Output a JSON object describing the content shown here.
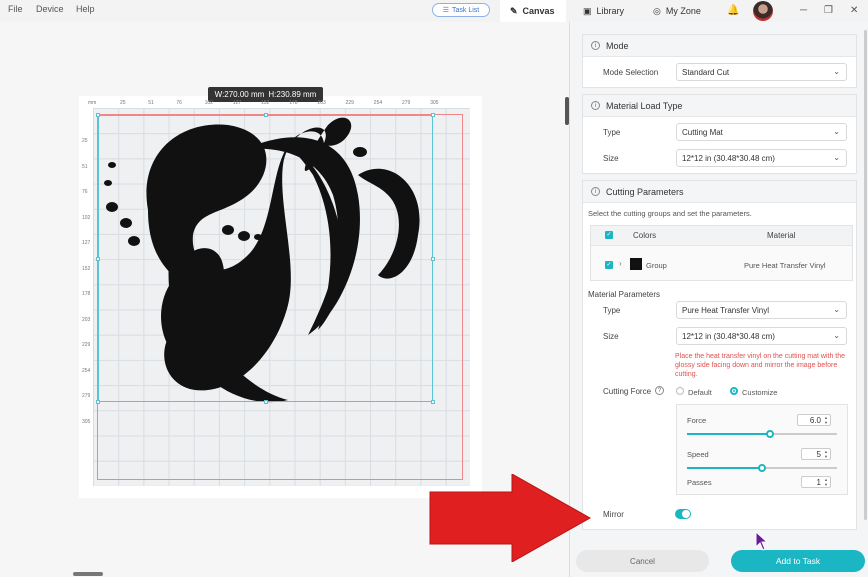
{
  "menu": {
    "file": "File",
    "device": "Device",
    "help": "Help"
  },
  "task_list": "Task List",
  "tabs": {
    "canvas": "Canvas",
    "library": "Library",
    "myzone": "My Zone"
  },
  "icons": {
    "task_list": "list-icon",
    "canvas": "canvas-icon",
    "library": "library-icon",
    "myzone": "myzone-icon",
    "bell": "bell-icon",
    "minimize": "minimize-icon",
    "restore": "restore-icon",
    "close": "close-icon"
  },
  "canvas": {
    "dimension_w": "W:270.00 mm",
    "dimension_h": "H:230.89 mm",
    "ruler_unit": "mm",
    "ruler_top": [
      "25",
      "51",
      "76",
      "102",
      "127",
      "152",
      "178",
      "203",
      "229",
      "254",
      "279",
      "305"
    ],
    "ruler_left": [
      "25",
      "51",
      "76",
      "102",
      "127",
      "152",
      "178",
      "203",
      "229",
      "254",
      "279",
      "305"
    ]
  },
  "panel": {
    "mode": {
      "title": "Mode",
      "selection_label": "Mode Selection",
      "selection_value": "Standard Cut"
    },
    "material_load": {
      "title": "Material Load Type",
      "type_label": "Type",
      "type_value": "Cutting Mat",
      "size_label": "Size",
      "size_value": "12*12 in (30.48*30.48 cm)"
    },
    "cutting": {
      "title": "Cutting Parameters",
      "instruction": "Select the cutting groups and set the parameters.",
      "col_colors": "Colors",
      "col_material": "Material",
      "group_label": "Group",
      "group_material": "Pure Heat Transfer Vinyl",
      "group_color": "#111111",
      "material_params_label": "Material Parameters",
      "type_label": "Type",
      "type_value": "Pure Heat Transfer Vinyl",
      "size_label": "Size",
      "size_value": "12*12 in (30.48*30.48 cm)",
      "warning": "Place the heat transfer vinyl on the cutting mat with the glossy side facing down and mirror the image before cutting.",
      "force_label": "Cutting Force",
      "option_default": "Default",
      "option_customize": "Customize",
      "force": {
        "label": "Force",
        "value": "6.0",
        "level": 0.55
      },
      "speed": {
        "label": "Speed",
        "value": "5",
        "level": 0.5
      },
      "passes": {
        "label": "Passes",
        "value": "1"
      },
      "mirror_label": "Mirror",
      "mirror_on": true
    }
  },
  "buttons": {
    "cancel": "Cancel",
    "add": "Add to Task"
  },
  "colors": {
    "accent": "#1ab6c4",
    "warning": "#e05050",
    "arrow": "#e02020"
  }
}
